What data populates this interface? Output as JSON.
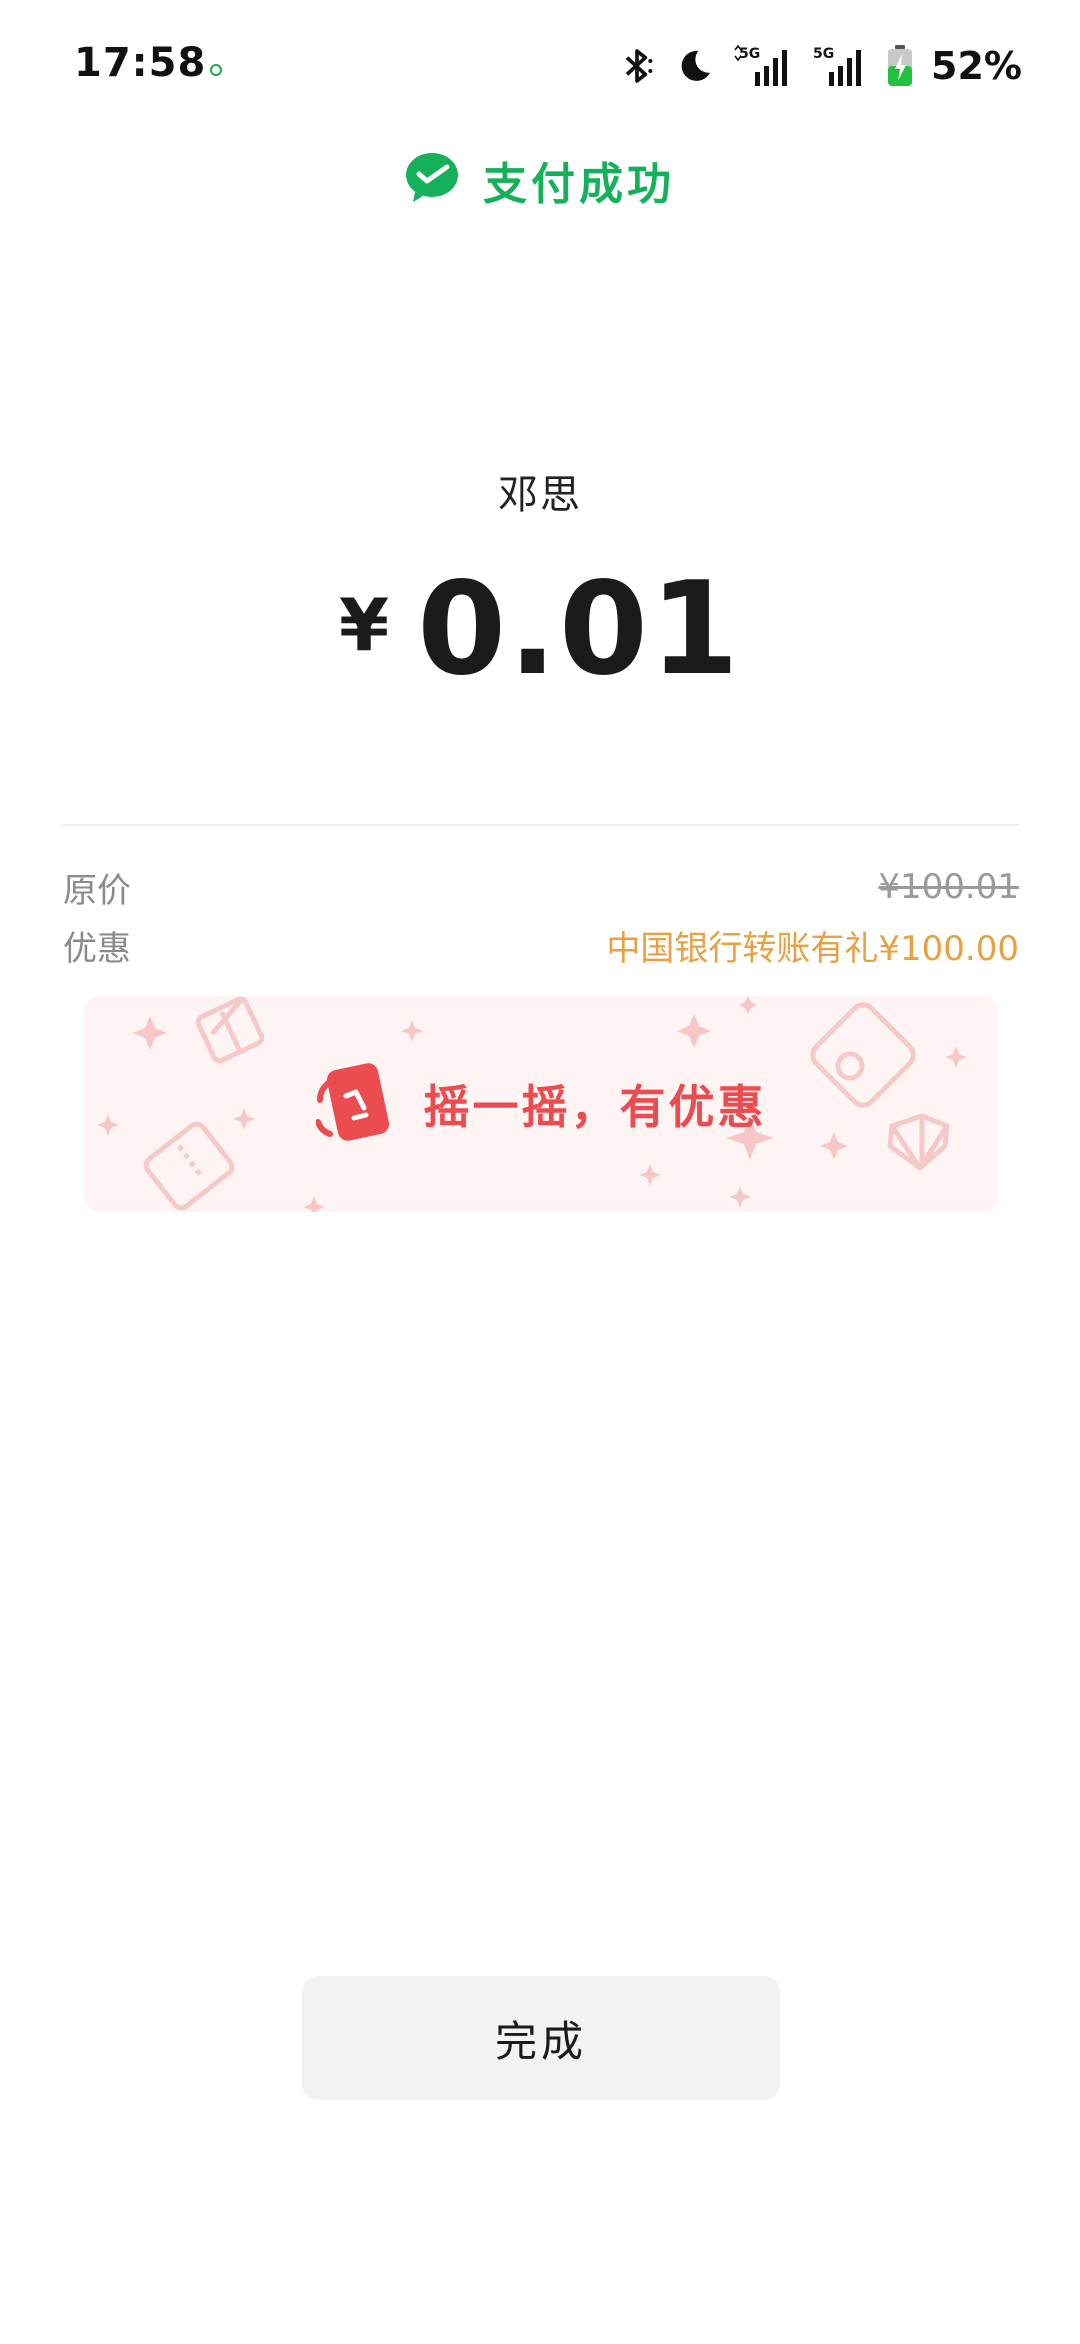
{
  "status_bar": {
    "time": "17:58",
    "battery": "52%",
    "network_1": "5G",
    "network_2": "5G"
  },
  "header": {
    "title": "支付成功",
    "icon": "wechat-pay-icon",
    "color": "#15b05a"
  },
  "payment": {
    "payee": "邓思",
    "currency": "¥",
    "amount": "0.01"
  },
  "details": {
    "original_label": "原价",
    "original_value": "¥100.01",
    "discount_label": "优惠",
    "discount_value": "中国银行转账有礼¥100.00",
    "discount_color": "#e8a142"
  },
  "banner": {
    "text": "摇一摇，有优惠",
    "icon": "shake-phone-icon",
    "color": "#ea4c50"
  },
  "actions": {
    "done_label": "完成"
  }
}
